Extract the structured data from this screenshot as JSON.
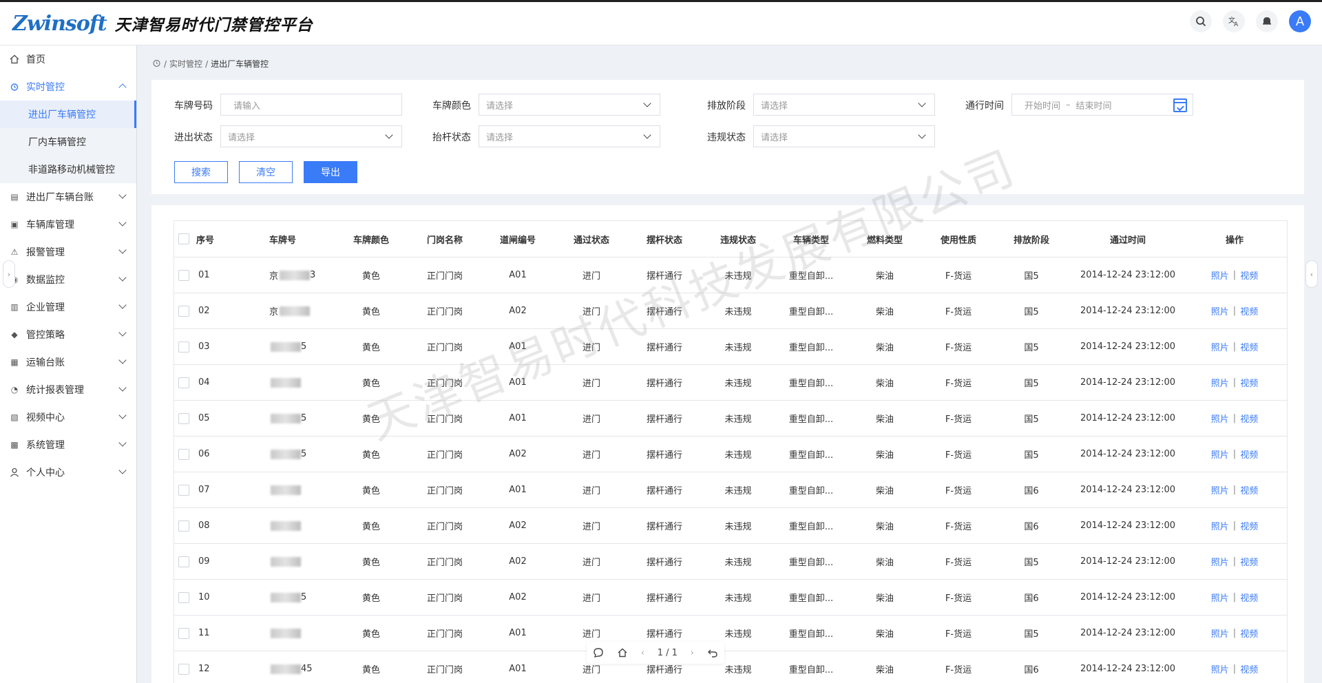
{
  "app": {
    "logo_text": "Zwinsoft",
    "title": "天津智易时代门禁管控平台"
  },
  "header": {
    "icons": [
      "search-icon",
      "translate-icon",
      "bell-icon"
    ],
    "avatar": "A"
  },
  "sidebar": {
    "items": [
      {
        "label": "首页",
        "icon": "home-icon"
      },
      {
        "label": "实时管控",
        "icon": "realtime-icon",
        "open": true,
        "children": [
          {
            "label": "进出厂车辆管控",
            "active": true
          },
          {
            "label": "厂内车辆管控"
          },
          {
            "label": "非道路移动机械管控"
          }
        ]
      },
      {
        "label": "进出厂车辆台账",
        "icon": "ledger-icon"
      },
      {
        "label": "车辆库管理",
        "icon": "vehicle-db-icon"
      },
      {
        "label": "报警管理",
        "icon": "alarm-icon"
      },
      {
        "label": "数据监控",
        "icon": "monitor-icon"
      },
      {
        "label": "企业管理",
        "icon": "enterprise-icon"
      },
      {
        "label": "管控策略",
        "icon": "strategy-icon"
      },
      {
        "label": "运输台账",
        "icon": "transport-icon"
      },
      {
        "label": "统计报表管理",
        "icon": "report-icon"
      },
      {
        "label": "视频中心",
        "icon": "video-icon"
      },
      {
        "label": "系统管理",
        "icon": "system-icon"
      },
      {
        "label": "个人中心",
        "icon": "user-icon"
      }
    ]
  },
  "breadcrumb": {
    "parent": "实时管控",
    "current": "进出厂车辆管控"
  },
  "filters": {
    "plate_no": {
      "label": "车牌号码",
      "placeholder": "请输入"
    },
    "plate_color": {
      "label": "车牌颜色",
      "placeholder": "请选择"
    },
    "emission_stage": {
      "label": "排放阶段",
      "placeholder": "请选择"
    },
    "pass_time": {
      "label": "通行时间",
      "start": "开始时间",
      "dash": "–",
      "end": "结束时间"
    },
    "in_out_status": {
      "label": "进出状态",
      "placeholder": "请选择"
    },
    "barrier_status": {
      "label": "抬杆状态",
      "placeholder": "请选择"
    },
    "violation_status": {
      "label": "违规状态",
      "placeholder": "请选择"
    },
    "buttons": {
      "search": "搜索",
      "clear": "清空",
      "export": "导出"
    }
  },
  "table": {
    "headers": [
      "序号",
      "车牌号",
      "车牌颜色",
      "门岗名称",
      "道闸编号",
      "通过状态",
      "摆杆状态",
      "违规状态",
      "车辆类型",
      "燃料类型",
      "使用性质",
      "排放阶段",
      "通过时间",
      "操作"
    ],
    "rows": [
      {
        "no": "01",
        "plate": "京",
        "plate_tail": "3",
        "color": "黄色",
        "gate": "正门门岗",
        "barrier_no": "A01",
        "pass": "进门",
        "swing": "摆杆通行",
        "violation": "未违规",
        "vtype": "重型自卸...",
        "fuel": "柴油",
        "usage": "F-货运",
        "stage": "国5",
        "time": "2014-12-24  23:12:00"
      },
      {
        "no": "02",
        "plate": "京",
        "plate_tail": "",
        "color": "黄色",
        "gate": "正门门岗",
        "barrier_no": "A02",
        "pass": "进门",
        "swing": "摆杆通行",
        "violation": "未违规",
        "vtype": "重型自卸...",
        "fuel": "柴油",
        "usage": "F-货运",
        "stage": "国5",
        "time": "2014-12-24  23:12:00"
      },
      {
        "no": "03",
        "plate": "",
        "plate_tail": "5",
        "color": "黄色",
        "gate": "正门门岗",
        "barrier_no": "A01",
        "pass": "进门",
        "swing": "摆杆通行",
        "violation": "未违规",
        "vtype": "重型自卸...",
        "fuel": "柴油",
        "usage": "F-货运",
        "stage": "国5",
        "time": "2014-12-24  23:12:00"
      },
      {
        "no": "04",
        "plate": "",
        "plate_tail": "",
        "color": "黄色",
        "gate": "正门门岗",
        "barrier_no": "A01",
        "pass": "进门",
        "swing": "摆杆通行",
        "violation": "未违规",
        "vtype": "重型自卸...",
        "fuel": "柴油",
        "usage": "F-货运",
        "stage": "国5",
        "time": "2014-12-24  23:12:00"
      },
      {
        "no": "05",
        "plate": "",
        "plate_tail": "5",
        "color": "黄色",
        "gate": "正门门岗",
        "barrier_no": "A01",
        "pass": "进门",
        "swing": "摆杆通行",
        "violation": "未违规",
        "vtype": "重型自卸...",
        "fuel": "柴油",
        "usage": "F-货运",
        "stage": "国5",
        "time": "2014-12-24  23:12:00"
      },
      {
        "no": "06",
        "plate": "",
        "plate_tail": "5",
        "color": "黄色",
        "gate": "正门门岗",
        "barrier_no": "A02",
        "pass": "进门",
        "swing": "摆杆通行",
        "violation": "未违规",
        "vtype": "重型自卸...",
        "fuel": "柴油",
        "usage": "F-货运",
        "stage": "国5",
        "time": "2014-12-24  23:12:00"
      },
      {
        "no": "07",
        "plate": "",
        "plate_tail": "",
        "color": "黄色",
        "gate": "正门门岗",
        "barrier_no": "A01",
        "pass": "进门",
        "swing": "摆杆通行",
        "violation": "未违规",
        "vtype": "重型自卸...",
        "fuel": "柴油",
        "usage": "F-货运",
        "stage": "国6",
        "time": "2014-12-24  23:12:00"
      },
      {
        "no": "08",
        "plate": "",
        "plate_tail": "",
        "color": "黄色",
        "gate": "正门门岗",
        "barrier_no": "A02",
        "pass": "进门",
        "swing": "摆杆通行",
        "violation": "未违规",
        "vtype": "重型自卸...",
        "fuel": "柴油",
        "usage": "F-货运",
        "stage": "国6",
        "time": "2014-12-24  23:12:00"
      },
      {
        "no": "09",
        "plate": "",
        "plate_tail": "",
        "color": "黄色",
        "gate": "正门门岗",
        "barrier_no": "A02",
        "pass": "进门",
        "swing": "摆杆通行",
        "violation": "未违规",
        "vtype": "重型自卸...",
        "fuel": "柴油",
        "usage": "F-货运",
        "stage": "国5",
        "time": "2014-12-24  23:12:00"
      },
      {
        "no": "10",
        "plate": "",
        "plate_tail": "5",
        "color": "黄色",
        "gate": "正门门岗",
        "barrier_no": "A02",
        "pass": "进门",
        "swing": "摆杆通行",
        "violation": "未违规",
        "vtype": "重型自卸...",
        "fuel": "柴油",
        "usage": "F-货运",
        "stage": "国6",
        "time": "2014-12-24  23:12:00"
      },
      {
        "no": "11",
        "plate": "",
        "plate_tail": "",
        "color": "黄色",
        "gate": "正门门岗",
        "barrier_no": "A01",
        "pass": "进门",
        "swing": "摆杆通行",
        "violation": "未违规",
        "vtype": "重型自卸...",
        "fuel": "柴油",
        "usage": "F-货运",
        "stage": "国5",
        "time": "2014-12-24  23:12:00"
      },
      {
        "no": "12",
        "plate": "",
        "plate_tail": "45",
        "color": "黄色",
        "gate": "正门门岗",
        "barrier_no": "A01",
        "pass": "进门",
        "swing": "摆杆通行",
        "violation": "未违规",
        "vtype": "重型自卸...",
        "fuel": "柴油",
        "usage": "F-货运",
        "stage": "国6",
        "time": "2014-12-24  23:12:00"
      }
    ],
    "actions": {
      "photo": "照片",
      "separator": "|",
      "video": "视频"
    }
  },
  "watermark": "天津智易时代科技发展有限公司",
  "pager": {
    "page_text": "1 / 1"
  },
  "colors": {
    "accent": "#3a7bf7",
    "sidebar_active_bg": "#e8eefa"
  }
}
